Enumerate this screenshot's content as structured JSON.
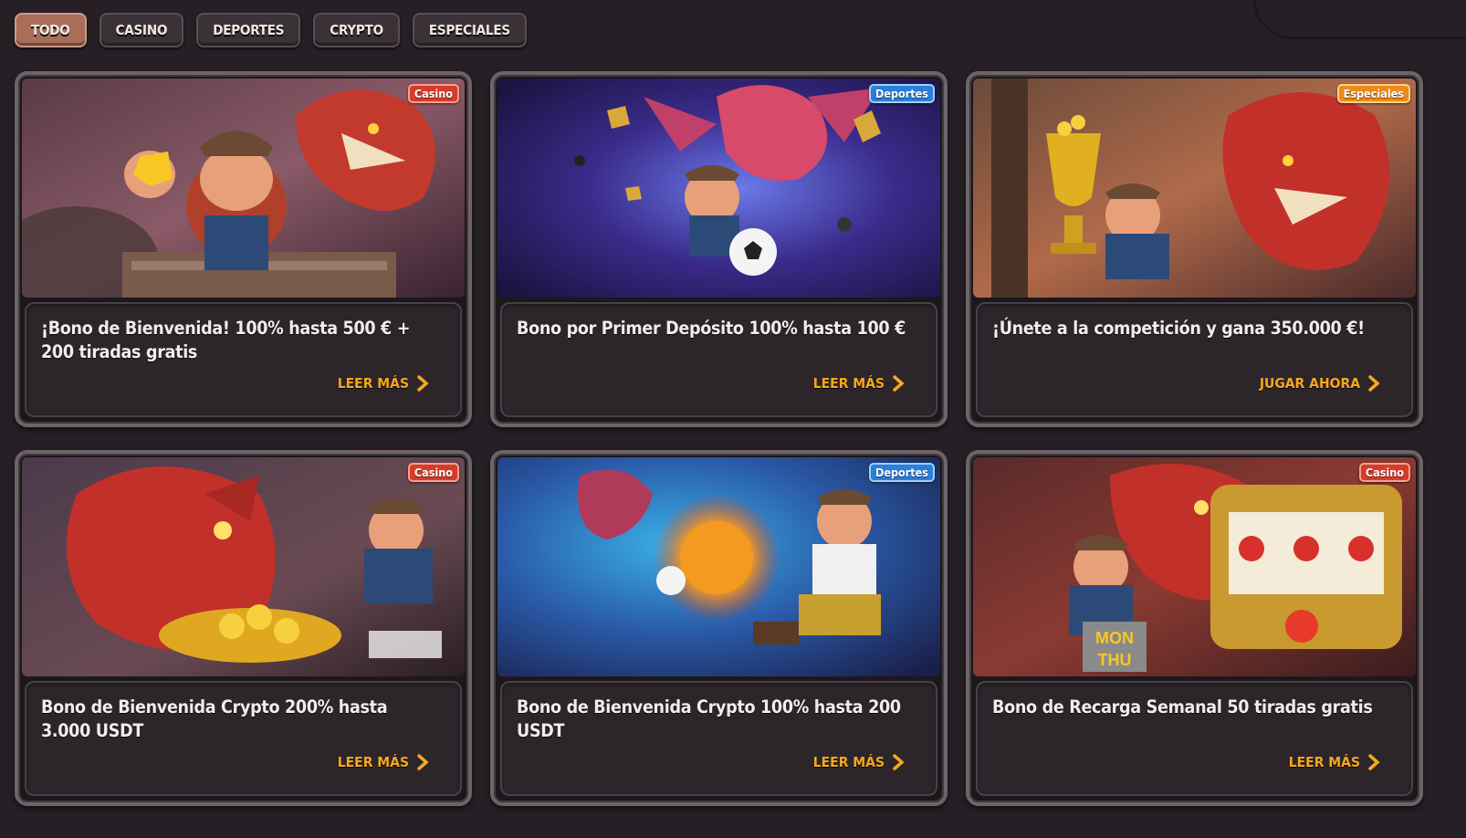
{
  "filters": {
    "tabs": [
      {
        "label": "TODO",
        "active": true
      },
      {
        "label": "CASINO",
        "active": false
      },
      {
        "label": "DEPORTES",
        "active": false
      },
      {
        "label": "CRYPTO",
        "active": false
      },
      {
        "label": "ESPECIALES",
        "active": false
      }
    ]
  },
  "colors": {
    "casino_badge": "#d63c2c",
    "deportes_badge": "#2a7fd8",
    "especiales_badge": "#ee8a1a",
    "cta": "#f7a81c",
    "active_tab": "#a86e5a"
  },
  "promotions": [
    {
      "badge": "Casino",
      "title": "¡Bono de Bienvenida! 100% hasta 500 € + 200 tiradas gratis",
      "cta": "LEER MÁS",
      "icon": "chevron-right-icon"
    },
    {
      "badge": "Deportes",
      "title": "Bono por Primer Depósito 100% hasta 100 €",
      "cta": "LEER MÁS",
      "icon": "chevron-right-icon"
    },
    {
      "badge": "Especiales",
      "title": "¡Únete a la competición y gana 350.000 €!",
      "cta": "JUGAR AHORA",
      "icon": "chevron-right-icon"
    },
    {
      "badge": "Casino",
      "title": "Bono de Bienvenida Crypto 200% hasta 3.000 USDT",
      "cta": "LEER MÁS",
      "icon": "chevron-right-icon"
    },
    {
      "badge": "Deportes",
      "title": "Bono de Bienvenida Crypto 100% hasta 200 USDT",
      "cta": "LEER MÁS",
      "icon": "chevron-right-icon"
    },
    {
      "badge": "Casino",
      "title": "Bono de Recarga Semanal 50 tiradas gratis",
      "cta": "LEER MÁS",
      "icon": "chevron-right-icon"
    }
  ],
  "images": {
    "slot_sign": [
      "MON",
      "THU"
    ]
  }
}
